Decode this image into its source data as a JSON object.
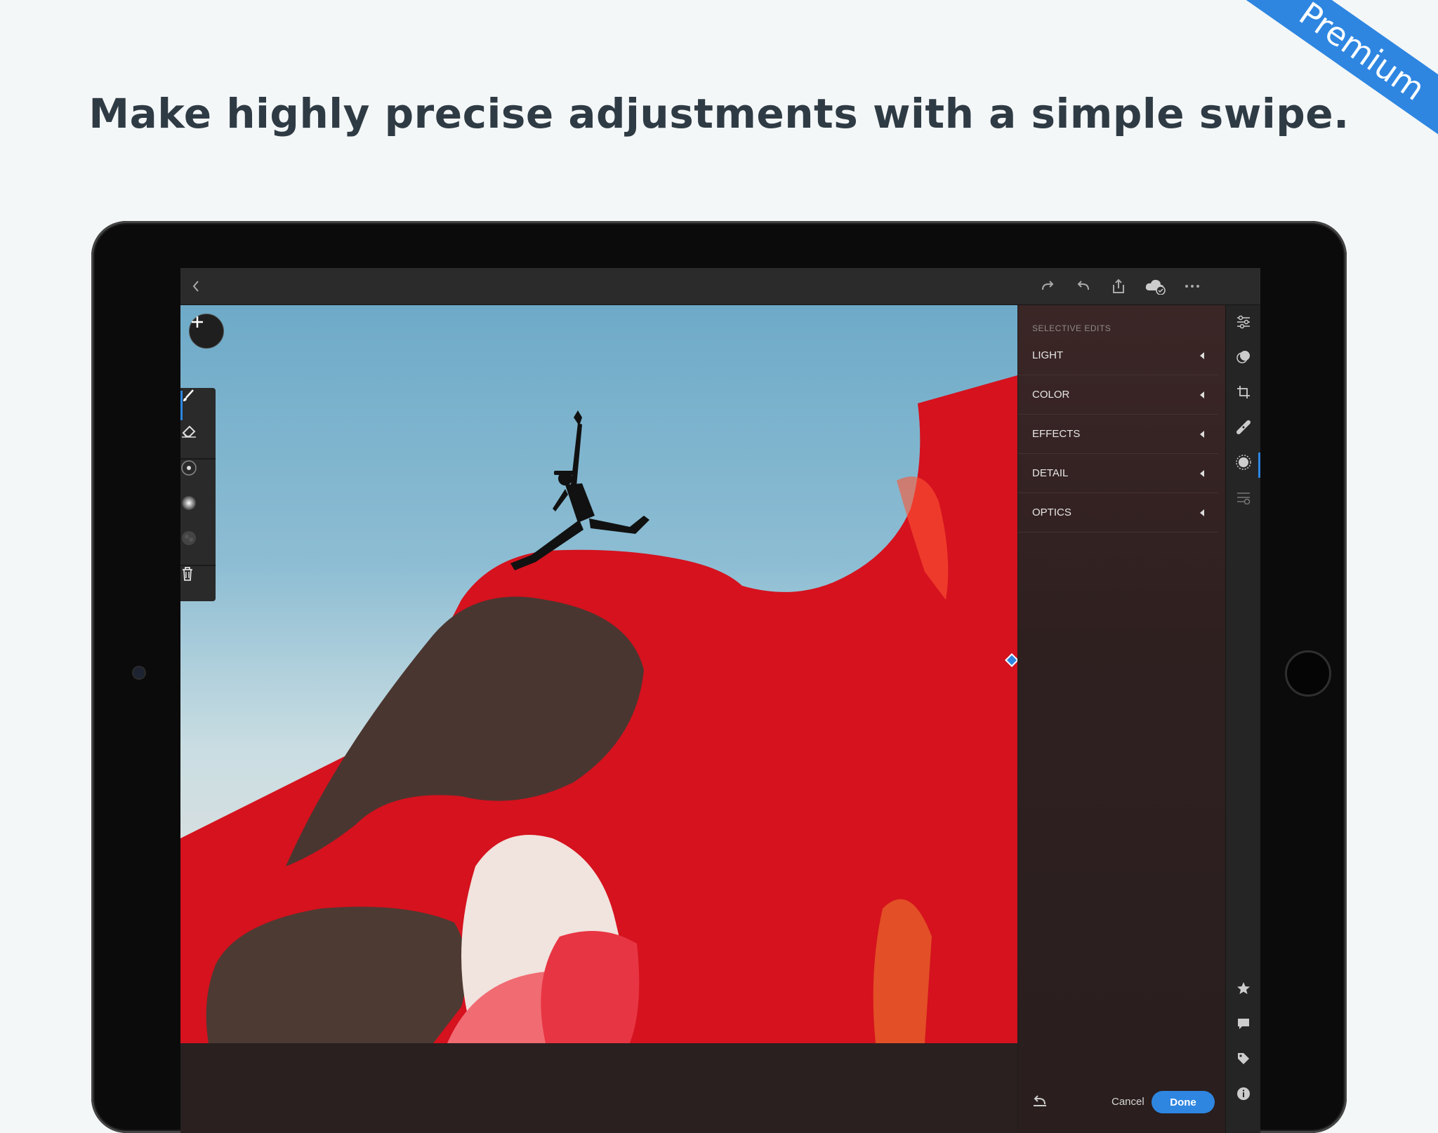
{
  "headline": "Make highly precise adjustments with a simple swipe.",
  "ribbon": "Premium",
  "panel": {
    "title": "SELECTIVE EDITS",
    "sections": [
      {
        "label": "LIGHT"
      },
      {
        "label": "COLOR"
      },
      {
        "label": "EFFECTS"
      },
      {
        "label": "DETAIL"
      },
      {
        "label": "OPTICS"
      }
    ],
    "cancel_label": "Cancel",
    "done_label": "Done"
  },
  "colors": {
    "accent": "#2e86e1",
    "mask_overlay": "#e0101e",
    "app_bg": "#1e1e1e"
  },
  "icons": {
    "topbar": [
      "back-icon",
      "redo-icon",
      "undo-icon",
      "share-icon",
      "cloud-sync-icon",
      "more-icon"
    ],
    "tools": [
      "brush-icon",
      "eraser-icon",
      "radial-gradient-icon",
      "linear-gradient-icon",
      "range-mask-icon",
      "delete-icon"
    ],
    "rail": [
      "edit-sliders-icon",
      "presets-icon",
      "crop-icon",
      "healing-icon",
      "selective-icon",
      "versions-icon",
      "rating-icon",
      "comment-icon",
      "tag-icon",
      "info-icon"
    ]
  }
}
